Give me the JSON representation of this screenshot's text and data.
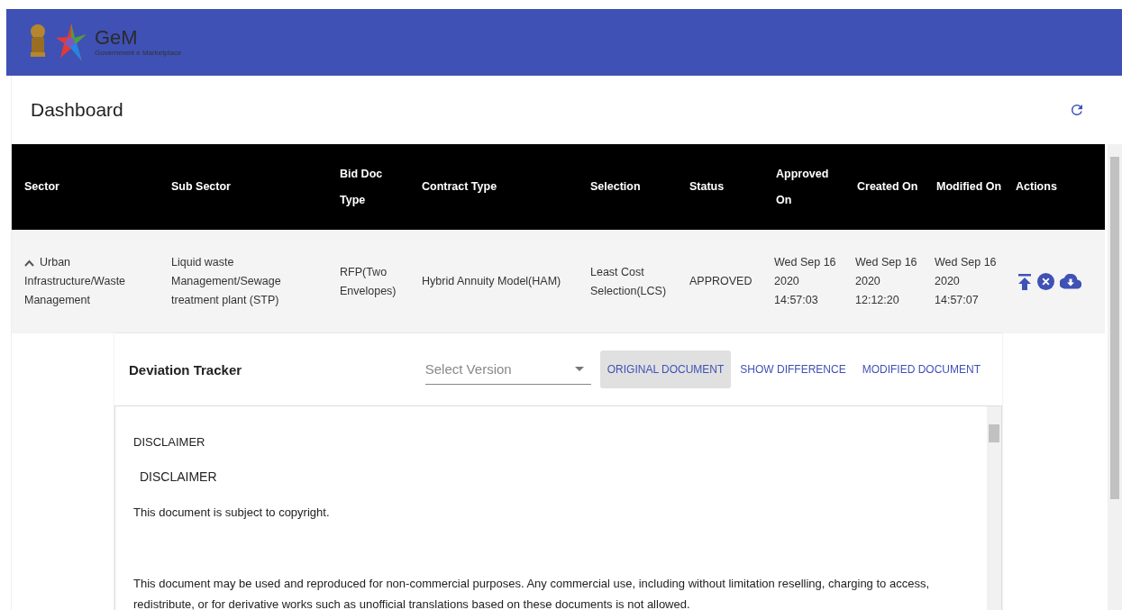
{
  "header": {
    "logo_title": "GeM",
    "logo_subtitle": "Government e Marketplace"
  },
  "page": {
    "title": "Dashboard"
  },
  "table": {
    "columns": [
      {
        "label": "Sector"
      },
      {
        "label": "Sub Sector"
      },
      {
        "label": "Bid Doc Type"
      },
      {
        "label": "Contract Type"
      },
      {
        "label": "Selection"
      },
      {
        "label": "Status"
      },
      {
        "label": "Approved On"
      },
      {
        "label": "Created On"
      },
      {
        "label": "Modified On"
      },
      {
        "label": "Actions"
      }
    ],
    "rows": [
      {
        "expanded": true,
        "cells": [
          "Urban Infrastructure/Waste Management",
          "Liquid waste Management/Sewage treatment plant (STP)",
          "RFP(Two Envelopes)",
          "Hybrid Annuity Model(HAM)",
          "Least Cost Selection(LCS)",
          "APPROVED",
          "Wed Sep 16 2020 14:57:03",
          "Wed Sep 16 2020 12:12:20",
          "Wed Sep 16 2020 14:57:07"
        ]
      }
    ]
  },
  "deviation_tracker": {
    "title": "Deviation Tracker",
    "version_select": {
      "placeholder": "Select Version"
    },
    "tabs": [
      {
        "label": "ORIGINAL DOCUMENT",
        "selected": true
      },
      {
        "label": "SHOW DIFFERENCE",
        "selected": false
      },
      {
        "label": "MODIFIED DOCUMENT",
        "selected": false
      }
    ],
    "document": [
      {
        "kind": "plain",
        "text": "DISCLAIMER"
      },
      {
        "kind": "heading",
        "text": "DISCLAIMER"
      },
      {
        "kind": "plain",
        "text": "This document is subject to copyright."
      },
      {
        "kind": "gap"
      },
      {
        "kind": "plain",
        "text": "This document may be used and reproduced for non-commercial purposes. Any commercial use, including without limitation reselling, charging to access, redistribute, or for derivative works such as unofficial translations based on these documents is not allowed."
      }
    ]
  }
}
